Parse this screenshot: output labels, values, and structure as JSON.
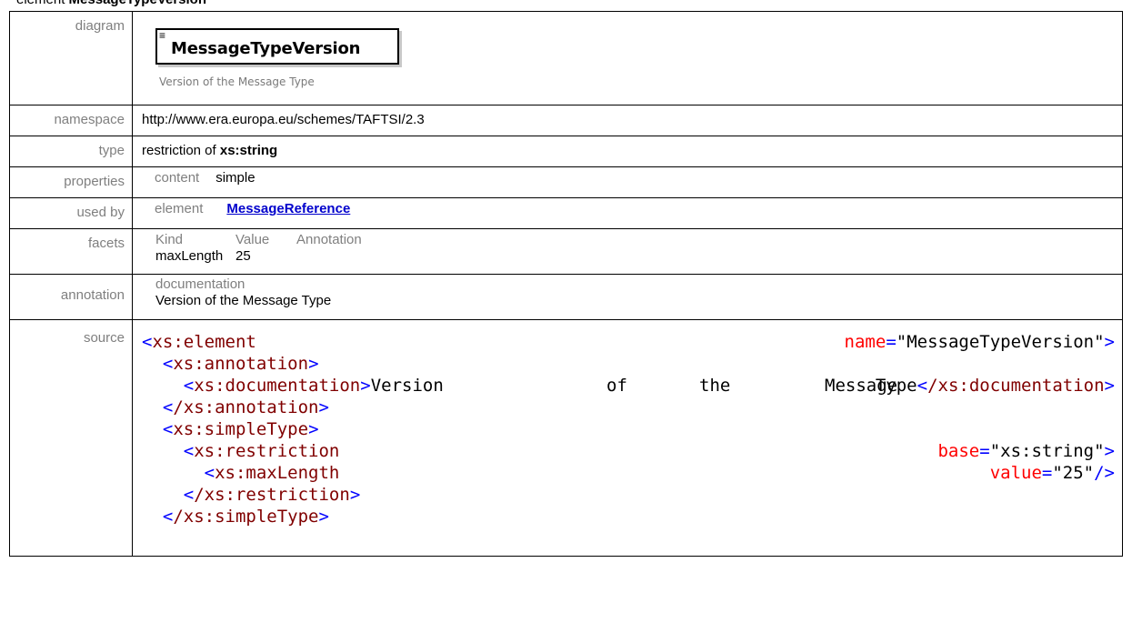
{
  "heading": {
    "prefix": "element ",
    "name": "MessageTypeVersion"
  },
  "diagram": {
    "label": "diagram",
    "element_name": "MessageTypeVersion",
    "icon": "≡",
    "description": "Version of the Message Type"
  },
  "namespace": {
    "label": "namespace",
    "value": "http://www.era.europa.eu/schemes/TAFTSI/2.3"
  },
  "type": {
    "label": "type",
    "prefix": "restriction of ",
    "base": "xs:string"
  },
  "properties": {
    "label": "properties",
    "key": "content",
    "value": "simple"
  },
  "used_by": {
    "label": "used by",
    "kind": "element",
    "link": "MessageReference"
  },
  "facets": {
    "label": "facets",
    "headers": [
      "Kind",
      "Value",
      "Annotation"
    ],
    "rows": [
      {
        "kind": "maxLength",
        "value": "25",
        "annotation": ""
      }
    ]
  },
  "annotation": {
    "label": "annotation",
    "key": "documentation",
    "text": "Version of the Message Type"
  },
  "source": {
    "label": "source",
    "l1_tag": "xs:element",
    "l1_attr": "name",
    "l1_val": "\"MessageTypeVersion\"",
    "l2_tag": "xs:annotation",
    "l3_tag": "xs:documentation",
    "l3_w1": "Version",
    "l3_w2": "of",
    "l3_w3": "the",
    "l3_w4": "Message",
    "l3_w5": "Type",
    "l3_close": "/xs:documentation",
    "l4_close": "/xs:annotation",
    "l5_tag": "xs:simpleType",
    "l6_tag": "xs:restriction",
    "l6_attr": "base",
    "l6_val": "\"xs:string\"",
    "l7_tag": "xs:maxLength",
    "l7_attr": "value",
    "l7_val": "\"25\"",
    "l8_close": "/xs:restriction",
    "l9_close": "/xs:simpleType"
  },
  "colors": {
    "tag": "#800000",
    "bracket": "#0000ff",
    "attribute": "#ff0000",
    "link": "#0000cc",
    "label": "#7f7f7f"
  }
}
